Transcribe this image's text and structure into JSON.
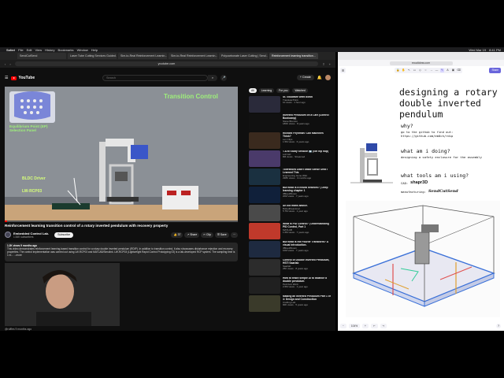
{
  "menubar": {
    "app": "Safari",
    "items": [
      "File",
      "Edit",
      "View",
      "History",
      "Bookmarks",
      "Window",
      "Help"
    ],
    "right": [
      "Wed Mar 19",
      "8:41 PM"
    ]
  },
  "left_browser": {
    "tabs": [
      "SendCutSend",
      "Laser Tube Cutting Services Guided...",
      "Sim-to-Real Reinforcement Learnin...",
      "Sim-to-Real Reinforcement Learnin...",
      "Polycarbonate Laser Cutting | Send...",
      "Reinforcement learning transition..."
    ],
    "url": "youtube.com",
    "bookmarks": [
      "Favorites",
      "Apple",
      "Yahoo",
      "Bing",
      "Google",
      "Wikipedia",
      "News"
    ]
  },
  "youtube": {
    "logo": "YouTube",
    "search_placeholder": "Search",
    "create_label": "+ Create",
    "player": {
      "overlay_title": "Transition Control",
      "ep_label": "Equilibrium Point (EP)\nSelection Panel",
      "label_bldc": "BLDC Driver",
      "label_lw": "LW-RCP03",
      "progress": 0.0
    },
    "video_title": "Reinforcement learning transition control of a rotary inverted pendulum with recovery property",
    "channel_name": "Embedded Control Lab.",
    "channel_subs": "1.54K subscribers",
    "subscribe_label": "Subscribe",
    "actions": {
      "like": "👍 37",
      "share": "↗ Share",
      "clip": "✂ Clip",
      "save": "☰ Save"
    },
    "description": {
      "meta": "1.2K views  9 months ago",
      "text": "This video demonstrates reinforcement learning-based transition control for a rotary double inverted pendulum (RDIP). In addition to transition control, it also showcases disturbance rejection and recovery properties. The control implementation was carried out using LW-RCP03 and MATLAB/Simulink. LW-RCP03 (Lightweight Rapid Control Prototyping 03) is a lab-developed RCP system. The sampling time is 1 m... ...more"
    },
    "comment_user": "@ruffles 9 months ago",
    "chips": [
      "All",
      "Learning",
      "For you",
      "Watched"
    ],
    "recommended": [
      {
        "title": "St. cloudfare went down",
        "channel": "TranslateThink",
        "views": "10 views · 1 hour ago",
        "color": "#2a2a3a"
      },
      {
        "title": "Inverted Pendulum on a Cart (Control Bootcamp)",
        "channel": "Steve Brunton",
        "views": "186K views · 8 years ago",
        "color": "#111111"
      },
      {
        "title": "Richard Feynman: Can Machines Think?",
        "channel": "Lex Clips",
        "views": "1.5M views · 6 years ago",
        "color": "#3a2a1e"
      },
      {
        "title": "T.A.M Study Session 🔄 (lofi hip hop)",
        "channel": "Lofi Girl",
        "views": "8M views · Streamed",
        "color": "#4a3a6a"
      },
      {
        "title": "Tolerances Didn't Make Sense Until I Learned This",
        "channel": "Engineering Gone Wild",
        "views": "298K views · 3 months ago",
        "color": "#1a3040"
      },
      {
        "title": "But what is a neural network? | Deep learning chapter 1",
        "channel": "3Blue1Brown",
        "views": "20M views · 7 years ago",
        "color": "#10203a"
      },
      {
        "title": "An old mans advice.",
        "channel": "Boltedtheanimal",
        "views": "5.7M views · 1 year ago",
        "color": "#4a4a4a"
      },
      {
        "title": "What is PID Control? | Understanding PID Control, Part 1",
        "channel": "MATLAB",
        "views": "1.6M views · 7 years ago",
        "color": "#c0392b"
      },
      {
        "title": "But what is the Fourier Transform? A visual introduction.",
        "channel": "3Blue1Brown",
        "views": "10M views · 7 years ago",
        "color": "#1e2a40"
      },
      {
        "title": "Control of Double Inverted Pendulum, HSTI Saarlab",
        "channel": "Saarlab",
        "views": "25K views · 8 years ago",
        "color": "#2c2c2c"
      },
      {
        "title": "How to teach simple AI to balance a double pendulum",
        "channel": "Pezzza's Work",
        "views": "2.6M views · 1 year ago",
        "color": "#202020"
      },
      {
        "title": "Making an Inverted Pendulum Part 1 of 4: Design and Construction",
        "channel": "Crafting Lab",
        "views": "90K views · 5 years ago",
        "color": "#3a3a2a"
      }
    ]
  },
  "right_browser": {
    "url": "excalidraw.com",
    "share_label": "Share",
    "drawing": {
      "title": "designing a rotary double inverted pendulum",
      "why_heading": "why?",
      "why_text": "go to the github to find out:\nhttps://github.com/em0ch/rdip",
      "what_heading": "what am i doing?",
      "what_text": "designing a safety enclosure for the assembly",
      "tools_heading": "what tools am i using?",
      "cad_label": "CAD:",
      "cad_tool": "shapr3D",
      "mfg_label": "manufacturing:",
      "mfg_tool": "SendCutSend"
    },
    "zoom": "104%"
  }
}
